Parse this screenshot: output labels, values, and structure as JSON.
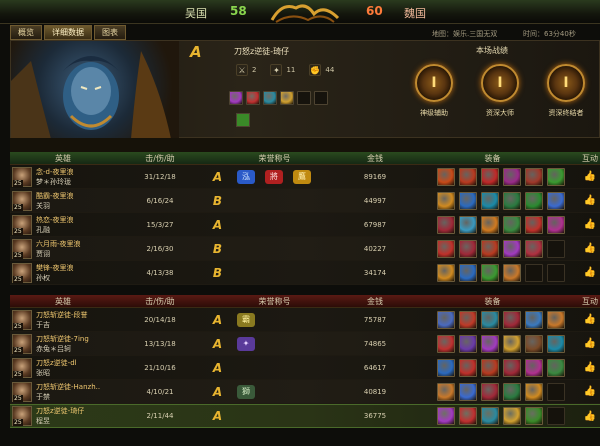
{
  "top": {
    "wu_label": "吴国",
    "wu_score": "58",
    "wei_score": "60",
    "wei_label": "魏国"
  },
  "tabs": [
    "概览",
    "详细数据",
    "图表"
  ],
  "info": {
    "map": "地图：娱乐.三国无双",
    "time": "时间：63分40秒"
  },
  "featured": {
    "hero": "程昱",
    "grade": "A",
    "title": "刀怒z逆徒-琦仔",
    "kills_icon": "swords-icon",
    "stat1": "2",
    "stat2": "11",
    "stat3": "44",
    "stats_title": "本场战绩",
    "medals": [
      {
        "label": "神级辅助",
        "icon": "medal-icon"
      },
      {
        "label": "资深大师",
        "icon": "medal-icon"
      },
      {
        "label": "资深终结者",
        "icon": "medal-icon"
      }
    ],
    "equip_colors": [
      "#a23ac0",
      "#c03030",
      "#2a8aa0",
      "#d0a030",
      "#16130d",
      "#16130d"
    ],
    "extra_color": "#3a8a28"
  },
  "headers": {
    "hero": "英雄",
    "kda": "击/伤/助",
    "honor": "荣誉称号",
    "gold": "金钱",
    "equip": "装备",
    "act": "互动"
  },
  "team1": [
    {
      "player": "念-d-夜里浪",
      "hero": "梦＊孙玲珑",
      "level": "25",
      "kda": "31/12/18",
      "grade": "A",
      "gold": "89169",
      "badges": [
        {
          "t": "泓",
          "c": "#2a5ac8",
          "f": "#cfe4ff"
        },
        {
          "t": "將",
          "c": "#b02020",
          "f": "#ffe0e0"
        },
        {
          "t": "鷹",
          "c": "#c08a10",
          "f": "#fff0b0"
        }
      ],
      "equip": [
        "#c84a18",
        "#b83a20",
        "#c02828",
        "#9a2a8a",
        "#a0382a",
        "#3a9a30"
      ]
    },
    {
      "player": "酷霸-夜里浪",
      "hero": "关羽",
      "level": "25",
      "kda": "6/16/24",
      "grade": "B",
      "gold": "44997",
      "badges": [],
      "equip": [
        "#d08a20",
        "#2a6ac0",
        "#1a8aa8",
        "#2a7a40",
        "#2a8a30",
        "#3a6ad0"
      ]
    },
    {
      "player": "热恋-夜里浪",
      "hero": "孔融",
      "level": "25",
      "kda": "15/3/27",
      "grade": "A",
      "gold": "67987",
      "badges": [],
      "equip": [
        "#a02838",
        "#3a9ac0",
        "#d07a20",
        "#3a8a40",
        "#c0302a",
        "#b03090"
      ]
    },
    {
      "player": "六月雨-夜里浪",
      "hero": "贾诩",
      "level": "25",
      "kda": "2/16/30",
      "grade": "B",
      "gold": "40227",
      "badges": [],
      "equip": [
        "#c0302a",
        "#a02838",
        "#b83a20",
        "#a23ac0",
        "#b03040",
        "empty"
      ]
    },
    {
      "player": "樊锋-夜里浪",
      "hero": "孙权",
      "level": "25",
      "kda": "4/13/38",
      "grade": "B",
      "gold": "34174",
      "badges": [],
      "equip": [
        "#d08a20",
        "#2a6ac0",
        "#3a9a30",
        "#c8782a",
        "empty",
        "empty"
      ]
    }
  ],
  "team2": [
    {
      "player": "刀怒斩逆徒-段誉",
      "hero": "于吉",
      "level": "25",
      "kda": "20/14/18",
      "grade": "A",
      "gold": "75787",
      "badges": [
        {
          "t": "霸",
          "c": "#8a7a20",
          "f": "#fff2a0"
        }
      ],
      "equip": [
        "#4a6ac0",
        "#c03a28",
        "#2a8aa0",
        "#a02838",
        "#3a7ac0",
        "#c8782a"
      ]
    },
    {
      "player": "刀怒斩逆徒-7ing",
      "hero": "赤兔＊吕轲",
      "level": "25",
      "kda": "13/13/18",
      "grade": "A",
      "gold": "74865",
      "badges": [
        {
          "t": "✦",
          "c": "#5a3a9a",
          "f": "#e6d0ff"
        }
      ],
      "equip": [
        "#c03030",
        "#6a3aa8",
        "#a23ac0",
        "#d0a030",
        "#7a4a28",
        "#1a8aa8"
      ]
    },
    {
      "player": "刀怒z逆徒-dl",
      "hero": "张昭",
      "level": "25",
      "kda": "21/10/16",
      "grade": "A",
      "gold": "64617",
      "badges": [],
      "equip": [
        "#2a6ac0",
        "#c0302a",
        "#b83a20",
        "#a02838",
        "#b03090",
        "#3a8a40"
      ]
    },
    {
      "player": "刀怒斩逆徒-Hanzh..",
      "hero": "于禁",
      "level": "25",
      "kda": "4/10/21",
      "grade": "A",
      "gold": "40819",
      "badges": [
        {
          "t": "獅",
          "c": "#3a5a3a",
          "f": "#cfe8c0"
        }
      ],
      "equip": [
        "#c8782a",
        "#3a6ad0",
        "#a02838",
        "#2a7a40",
        "#d08a20",
        "empty"
      ]
    },
    {
      "player": "刀怒z逆徒-琦仔",
      "hero": "程昱",
      "level": "25",
      "kda": "2/11/44",
      "grade": "A",
      "gold": "36775",
      "badges": [],
      "equip": [
        "#a23ac0",
        "#c03030",
        "#2a8aa0",
        "#d0a030",
        "#3a8a28",
        "empty"
      ],
      "me": true
    }
  ]
}
